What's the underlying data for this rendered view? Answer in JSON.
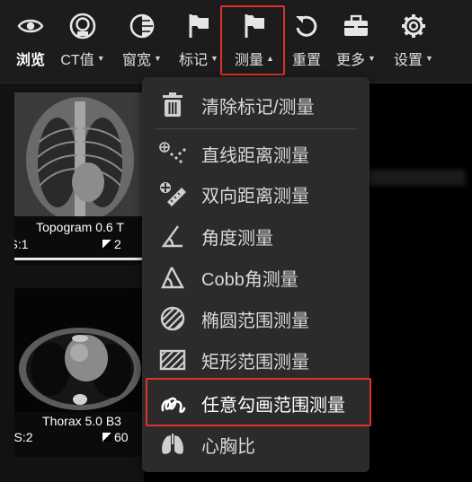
{
  "toolbar": {
    "items": [
      {
        "label": "浏览",
        "icon": "eye-icon",
        "dropdown": false
      },
      {
        "label": "CT值",
        "icon": "ct-value-icon",
        "dropdown": true
      },
      {
        "label": "窗宽",
        "icon": "contrast-icon",
        "dropdown": true
      },
      {
        "label": "标记",
        "icon": "flag-icon",
        "dropdown": true
      },
      {
        "label": "测量",
        "icon": "measure-flag-icon",
        "dropdown": true
      },
      {
        "label": "重置",
        "icon": "reset-icon",
        "dropdown": false
      },
      {
        "label": "更多",
        "icon": "toolbox-icon",
        "dropdown": true
      },
      {
        "label": "设置",
        "icon": "gear-icon",
        "dropdown": true
      }
    ]
  },
  "series": [
    {
      "title": "Topogram 0.6 T",
      "info": "S:1",
      "count": "2"
    },
    {
      "title": "Thorax 5.0 B3",
      "info": "S:2",
      "count": "60"
    }
  ],
  "measure_menu": {
    "items": [
      {
        "label": "清除标记/测量",
        "icon": "trash-icon"
      },
      {
        "label": "直线距离测量",
        "icon": "line-distance-icon"
      },
      {
        "label": "双向距离测量",
        "icon": "bidirectional-distance-icon"
      },
      {
        "label": "角度测量",
        "icon": "angle-icon"
      },
      {
        "label": "Cobb角测量",
        "icon": "cobb-angle-icon"
      },
      {
        "label": "椭圆范围测量",
        "icon": "ellipse-roi-icon"
      },
      {
        "label": "矩形范围测量",
        "icon": "rectangle-roi-icon"
      },
      {
        "label": "任意勾画范围测量",
        "icon": "freehand-roi-icon"
      },
      {
        "label": "心胸比",
        "icon": "cardiothoracic-ratio-icon"
      }
    ]
  },
  "colors": {
    "highlight": "#e0302a",
    "menu_bg": "#2b2b2b",
    "toolbar_bg": "#1c1c1c"
  }
}
